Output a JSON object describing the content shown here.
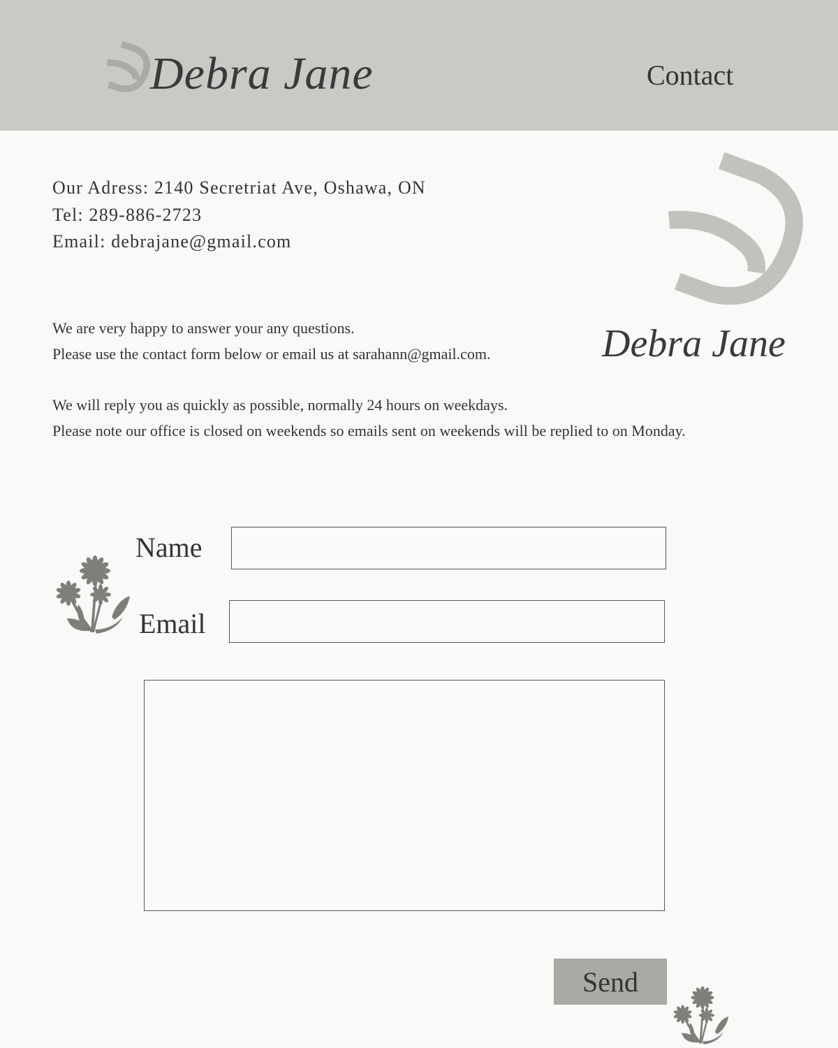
{
  "header": {
    "brand": "Debra Jane",
    "nav_contact": "Contact"
  },
  "contact_info": {
    "address": "Our Adress: 2140 Secretriat Ave, Oshawa, ON",
    "tel": "Tel: 289-886-2723",
    "email": "Email: debrajane@gmail.com"
  },
  "messages": {
    "line1": "We are very happy to answer your any questions.",
    "line2": "Please use the contact form below or email us at sarahann@gmail.com.",
    "line3": "We will reply you as quickly as possible, normally 24 hours on weekdays.",
    "line4": "Please note our office is closed on weekends so emails sent on weekends will be replied to on Monday."
  },
  "side_brand": "Debra Jane",
  "form": {
    "name_label": "Name",
    "email_label": "Email",
    "name_value": "",
    "email_value": "",
    "message_value": "",
    "send_label": "Send"
  },
  "colors": {
    "header_bg": "#c8cac5",
    "page_bg": "#f9f9f7",
    "logo_mark": "#a9aba6",
    "button_bg": "#a8aaa6",
    "flower": "#7d7f7b"
  },
  "icons": {
    "logo": "dj-monogram-icon",
    "flower": "daisy-flower-icon"
  }
}
